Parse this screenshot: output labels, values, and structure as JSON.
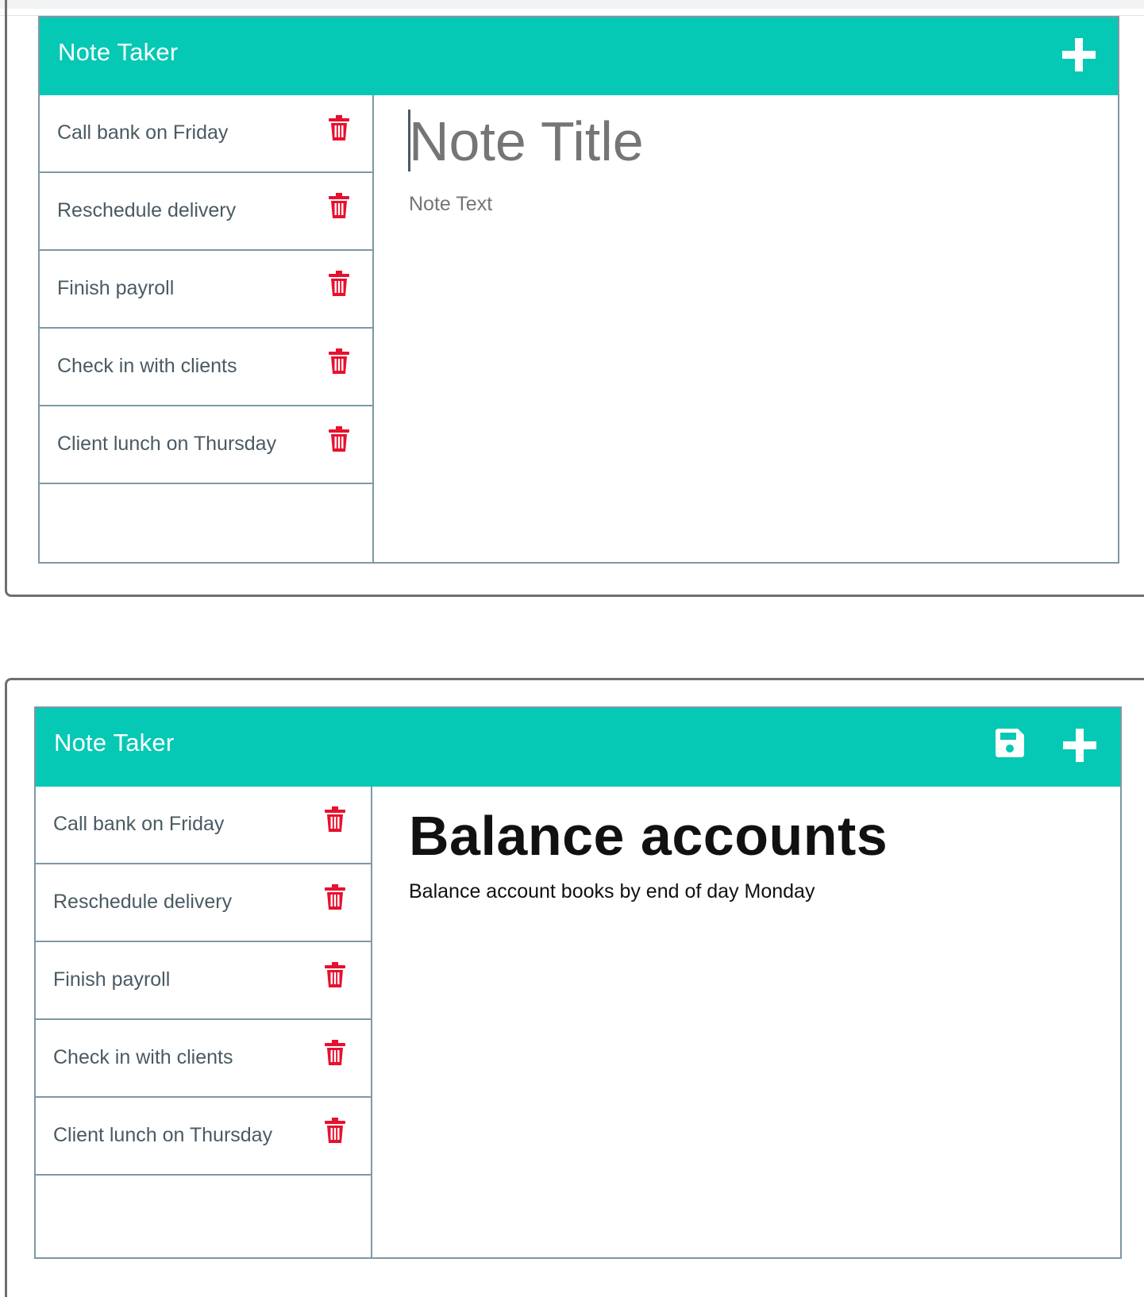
{
  "colors": {
    "header": "#05c9b4",
    "border": "#7d98a5",
    "text": "#4a5a63",
    "trash": "#e8102e"
  },
  "panel_a": {
    "app_title": "Note Taker",
    "notes": [
      {
        "title": "Call bank on Friday"
      },
      {
        "title": "Reschedule delivery"
      },
      {
        "title": "Finish payroll"
      },
      {
        "title": "Check in with clients"
      },
      {
        "title": "Client lunch on Thursday"
      }
    ],
    "editor": {
      "title_placeholder": "Note Title",
      "text_placeholder": "Note Text"
    },
    "icons": {
      "new_note": "plus-icon",
      "delete": "trash-icon"
    }
  },
  "panel_b": {
    "app_title": "Note Taker",
    "notes": [
      {
        "title": "Call bank on Friday"
      },
      {
        "title": "Reschedule delivery"
      },
      {
        "title": "Finish payroll"
      },
      {
        "title": "Check in with clients"
      },
      {
        "title": "Client lunch on Thursday"
      }
    ],
    "editor": {
      "title": "Balance accounts",
      "text": "Balance account books by end of day Monday"
    },
    "icons": {
      "save_note": "save-icon",
      "new_note": "plus-icon",
      "delete": "trash-icon"
    }
  }
}
